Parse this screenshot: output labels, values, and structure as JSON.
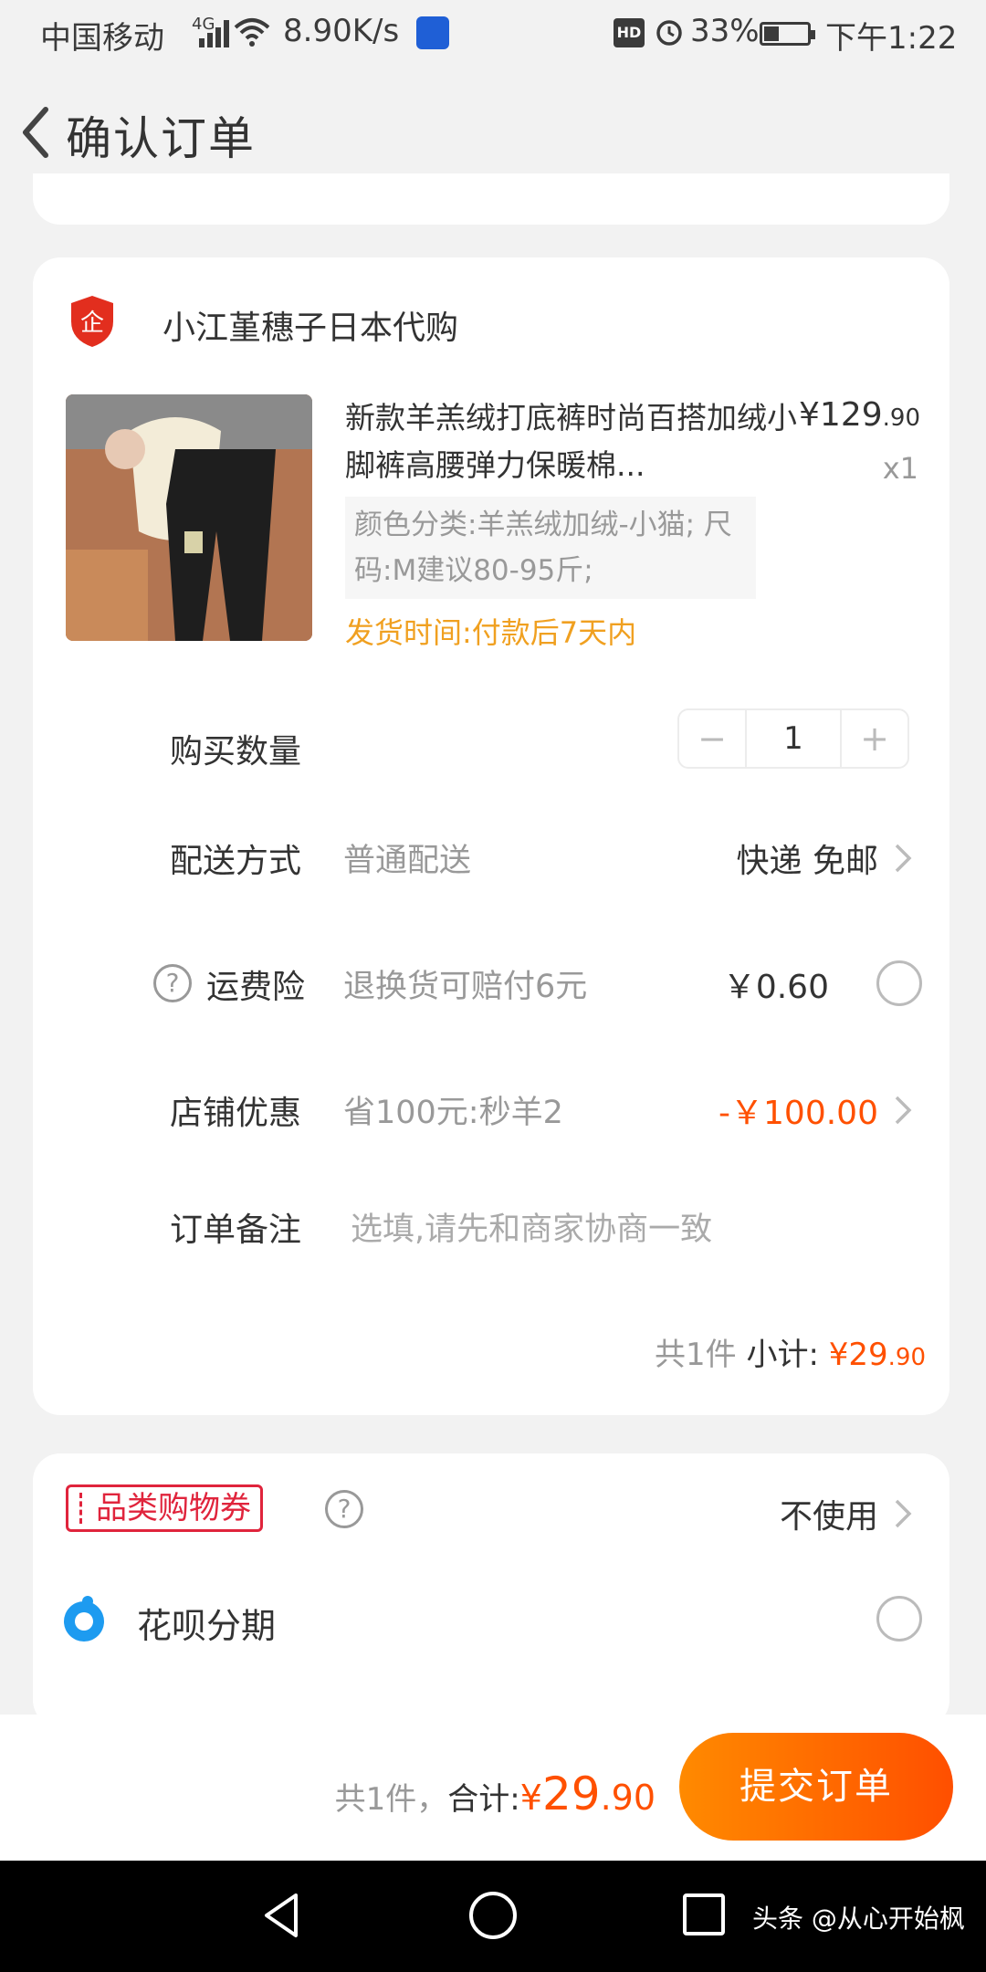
{
  "status_bar": {
    "carrier": "中国移动",
    "network": "4G",
    "speed": "8.90K/s",
    "hd": "HD",
    "battery": "33%",
    "time": "下午1:22"
  },
  "header": {
    "title": "确认订单"
  },
  "shop": {
    "name": "小江堇穗子日本代购",
    "icon": "enterprise-shield-icon",
    "icon_text": "企"
  },
  "product": {
    "title": "新款羊羔绒打底裤时尚百搭加绒小脚裤高腰弹力保暖棉...",
    "price_symbol": "¥",
    "price_int": "129",
    "price_dec": ".90",
    "quantity": "x1",
    "sku": "颜色分类:羊羔绒加绒-小猫; 尺码:M建议80-95斤;",
    "ship_time": "发货时间:付款后7天内"
  },
  "order_rows": {
    "quantity": {
      "label": "购买数量",
      "minus": "−",
      "value": "1",
      "plus": "+"
    },
    "delivery": {
      "label": "配送方式",
      "value": "普通配送",
      "right": "快递 免邮"
    },
    "freight_insurance": {
      "label": "运费险",
      "value": "退换货可赔付6元",
      "right": "￥0.60"
    },
    "shop_discount": {
      "label": "店铺优惠",
      "value": "省100元:秒羊2",
      "right": "-￥100.00"
    },
    "note": {
      "label": "订单备注",
      "placeholder": "选填,请先和商家协商一致"
    }
  },
  "subtotal": {
    "count": "共1件 ",
    "label": "小计: ",
    "symbol": "¥",
    "int": "29",
    "dec": ".90"
  },
  "payment": {
    "coupon": {
      "label": "品类购物券",
      "right": "不使用"
    },
    "huabei": {
      "label": "花呗分期"
    }
  },
  "bottom_bar": {
    "count": "共1件，",
    "label": "合计:",
    "symbol": "¥",
    "int": "29",
    "dec": ".90",
    "submit": "提交订单"
  },
  "watermark": "头条 @从心开始枫",
  "colors": {
    "accent": "#ff5000",
    "ship_time": "#f0a020",
    "coupon": "#e0243c",
    "button_start": "#ff8a00",
    "button_end": "#ff4f00"
  }
}
